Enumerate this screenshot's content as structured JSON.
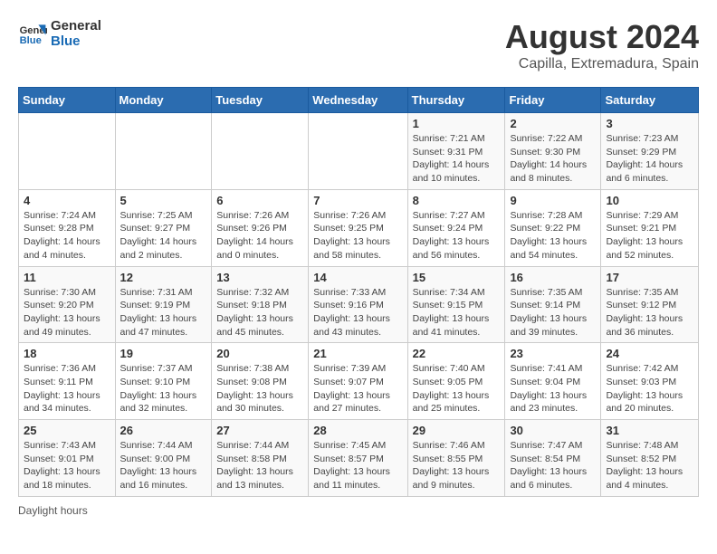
{
  "logo": {
    "line1": "General",
    "line2": "Blue"
  },
  "title": "August 2024",
  "subtitle": "Capilla, Extremadura, Spain",
  "days_of_week": [
    "Sunday",
    "Monday",
    "Tuesday",
    "Wednesday",
    "Thursday",
    "Friday",
    "Saturday"
  ],
  "weeks": [
    [
      {
        "day": "",
        "info": ""
      },
      {
        "day": "",
        "info": ""
      },
      {
        "day": "",
        "info": ""
      },
      {
        "day": "",
        "info": ""
      },
      {
        "day": "1",
        "info": "Sunrise: 7:21 AM\nSunset: 9:31 PM\nDaylight: 14 hours and 10 minutes."
      },
      {
        "day": "2",
        "info": "Sunrise: 7:22 AM\nSunset: 9:30 PM\nDaylight: 14 hours and 8 minutes."
      },
      {
        "day": "3",
        "info": "Sunrise: 7:23 AM\nSunset: 9:29 PM\nDaylight: 14 hours and 6 minutes."
      }
    ],
    [
      {
        "day": "4",
        "info": "Sunrise: 7:24 AM\nSunset: 9:28 PM\nDaylight: 14 hours and 4 minutes."
      },
      {
        "day": "5",
        "info": "Sunrise: 7:25 AM\nSunset: 9:27 PM\nDaylight: 14 hours and 2 minutes."
      },
      {
        "day": "6",
        "info": "Sunrise: 7:26 AM\nSunset: 9:26 PM\nDaylight: 14 hours and 0 minutes."
      },
      {
        "day": "7",
        "info": "Sunrise: 7:26 AM\nSunset: 9:25 PM\nDaylight: 13 hours and 58 minutes."
      },
      {
        "day": "8",
        "info": "Sunrise: 7:27 AM\nSunset: 9:24 PM\nDaylight: 13 hours and 56 minutes."
      },
      {
        "day": "9",
        "info": "Sunrise: 7:28 AM\nSunset: 9:22 PM\nDaylight: 13 hours and 54 minutes."
      },
      {
        "day": "10",
        "info": "Sunrise: 7:29 AM\nSunset: 9:21 PM\nDaylight: 13 hours and 52 minutes."
      }
    ],
    [
      {
        "day": "11",
        "info": "Sunrise: 7:30 AM\nSunset: 9:20 PM\nDaylight: 13 hours and 49 minutes."
      },
      {
        "day": "12",
        "info": "Sunrise: 7:31 AM\nSunset: 9:19 PM\nDaylight: 13 hours and 47 minutes."
      },
      {
        "day": "13",
        "info": "Sunrise: 7:32 AM\nSunset: 9:18 PM\nDaylight: 13 hours and 45 minutes."
      },
      {
        "day": "14",
        "info": "Sunrise: 7:33 AM\nSunset: 9:16 PM\nDaylight: 13 hours and 43 minutes."
      },
      {
        "day": "15",
        "info": "Sunrise: 7:34 AM\nSunset: 9:15 PM\nDaylight: 13 hours and 41 minutes."
      },
      {
        "day": "16",
        "info": "Sunrise: 7:35 AM\nSunset: 9:14 PM\nDaylight: 13 hours and 39 minutes."
      },
      {
        "day": "17",
        "info": "Sunrise: 7:35 AM\nSunset: 9:12 PM\nDaylight: 13 hours and 36 minutes."
      }
    ],
    [
      {
        "day": "18",
        "info": "Sunrise: 7:36 AM\nSunset: 9:11 PM\nDaylight: 13 hours and 34 minutes."
      },
      {
        "day": "19",
        "info": "Sunrise: 7:37 AM\nSunset: 9:10 PM\nDaylight: 13 hours and 32 minutes."
      },
      {
        "day": "20",
        "info": "Sunrise: 7:38 AM\nSunset: 9:08 PM\nDaylight: 13 hours and 30 minutes."
      },
      {
        "day": "21",
        "info": "Sunrise: 7:39 AM\nSunset: 9:07 PM\nDaylight: 13 hours and 27 minutes."
      },
      {
        "day": "22",
        "info": "Sunrise: 7:40 AM\nSunset: 9:05 PM\nDaylight: 13 hours and 25 minutes."
      },
      {
        "day": "23",
        "info": "Sunrise: 7:41 AM\nSunset: 9:04 PM\nDaylight: 13 hours and 23 minutes."
      },
      {
        "day": "24",
        "info": "Sunrise: 7:42 AM\nSunset: 9:03 PM\nDaylight: 13 hours and 20 minutes."
      }
    ],
    [
      {
        "day": "25",
        "info": "Sunrise: 7:43 AM\nSunset: 9:01 PM\nDaylight: 13 hours and 18 minutes."
      },
      {
        "day": "26",
        "info": "Sunrise: 7:44 AM\nSunset: 9:00 PM\nDaylight: 13 hours and 16 minutes."
      },
      {
        "day": "27",
        "info": "Sunrise: 7:44 AM\nSunset: 8:58 PM\nDaylight: 13 hours and 13 minutes."
      },
      {
        "day": "28",
        "info": "Sunrise: 7:45 AM\nSunset: 8:57 PM\nDaylight: 13 hours and 11 minutes."
      },
      {
        "day": "29",
        "info": "Sunrise: 7:46 AM\nSunset: 8:55 PM\nDaylight: 13 hours and 9 minutes."
      },
      {
        "day": "30",
        "info": "Sunrise: 7:47 AM\nSunset: 8:54 PM\nDaylight: 13 hours and 6 minutes."
      },
      {
        "day": "31",
        "info": "Sunrise: 7:48 AM\nSunset: 8:52 PM\nDaylight: 13 hours and 4 minutes."
      }
    ]
  ],
  "legend": {
    "daylight_hours": "Daylight hours"
  }
}
